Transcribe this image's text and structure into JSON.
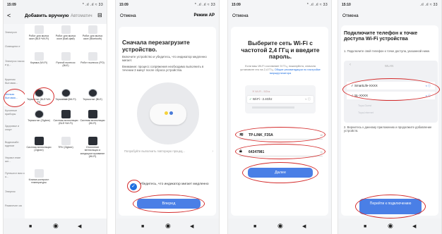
{
  "phone1": {
    "status_time": "15:09",
    "status_icons": "* .ıl .ıl ≈ 33",
    "back": "<",
    "title": "Добавить вручную",
    "auto": "Автоматич",
    "scan_icon": "scan-icon",
    "sidebar": [
      "Электрон",
      "Освещени е",
      "Электрос насос и д...",
      "Крупная бытовая...",
      "Мелкая бытовая...",
      "Кухонные приборы",
      "Здоровье и спорт",
      "Видеонабл юдение",
      "Управл ение шл...",
      "Путешест вия и о...",
      "Энергия",
      "Развлечен ия",
      "Промышл"
    ],
    "top_devices": [
      "Робот для мытья окон (BLE+Wi-Fi)",
      "Робот для мытья окон (Бай-фай)",
      "Робот для мытья окон (Bluetooth)",
      "Кормка (Wi-Fi)",
      "Ручной пылесос (BLE)",
      "Робот пылесос (PO)"
    ],
    "hvac_label": "HVAC",
    "hvac_devices": [
      "Термостат (BLE+Wi-Fi)",
      "Термостат (Wi-Fi)",
      "Термостат (BLE)",
      "Термостат (Zigbee)",
      "Система вентиляции (BLE+Wi-Fi)",
      "Система вентиляции (Wi-Fi)",
      "Система вентиляции (Zigbee)",
      "TRV (Zigbee)",
      "Отопление вентиляция и кондицион ирование (Wi-Fi)",
      "Клапан-контролл температуры"
    ],
    "motor_label": "Motor"
  },
  "phone2": {
    "status_time": "15:09",
    "status_icons": "* .ıl .ıl ≈ 33",
    "cancel": "Отмена",
    "mode": "Режим AP",
    "title": "Сначала перезагрузите устройство.",
    "text1": "Включите устройство и убедитесь, что индикатор медленно мигает.",
    "text2": "Внимание: процесс сопряжения необходимо выполнить в течении 3 минут после сброса устройства.",
    "other_method": "Попробуйте выполнить повторную процед...",
    "confirm_text": "Убедитесь, что индикатор мигает медленно",
    "next_button": "Вперед"
  },
  "phone3": {
    "status_time": "15:09",
    "status_icons": "* .ıl .ıl ≈ 33",
    "cancel": "Отмена",
    "title": "Выберите сеть Wi-Fi с частотой 2,4 ГГц и введите пароль.",
    "text": "Если ваш Wi-Fi составляет 5 ГГц, пожалуйста, сначала установите его на 2,4 ГГц.",
    "link": "Общие рекомендации по настройке маршрутизатора",
    "wifi_5g": "Wi-Fi - 5Ghz",
    "wifi_24g": "Wi-Fi - 2.4Ghz",
    "ssid": "TP-LINK_F35A",
    "password": "64347981",
    "next_button": "Далее"
  },
  "phone4": {
    "status_time": "15:10",
    "status_icons": ".ıl .ıl ≈ 33",
    "cancel": "Отмена",
    "title": "Подключите телефон к точке доступа Wi-Fi устройства",
    "step1": "1. Подключите свой телефон к точке доступа, указанной ниже.",
    "wlan_label": "WLAN",
    "ap1": "SmartLife-XXXX",
    "ap2": "SL-XXXX",
    "faint1": "Tuya-Guest",
    "faint2": "Tuya-Internet",
    "step2": "2. Вернитесь к данному приложению и продолжите добавление устройств.",
    "connect_button": "Перейти к подключению"
  },
  "accent_blue": "#4a7fe6",
  "highlight_red": "#d42b2b"
}
